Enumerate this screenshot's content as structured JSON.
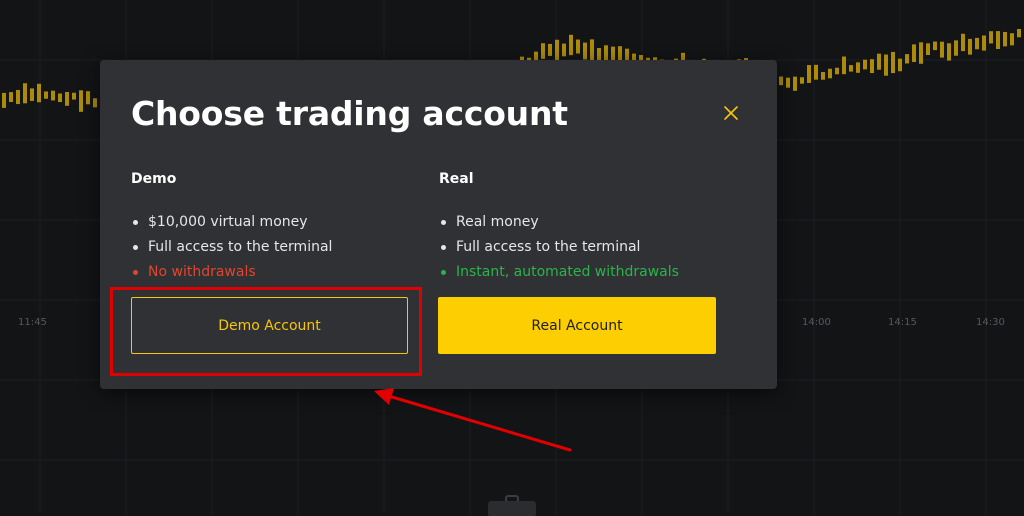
{
  "background": {
    "time_labels": [
      "11:45",
      "14:00",
      "14:15",
      "14:30"
    ],
    "candle_color": "#c9a008"
  },
  "modal": {
    "title": "Choose trading account",
    "close_icon": "close-x-icon",
    "demo": {
      "title": "Demo",
      "features": [
        {
          "text": "$10,000 virtual money",
          "status": "neutral"
        },
        {
          "text": "Full access to the terminal",
          "status": "neutral"
        },
        {
          "text": "No withdrawals",
          "status": "negative"
        }
      ],
      "button_label": "Demo Account"
    },
    "real": {
      "title": "Real",
      "features": [
        {
          "text": "Real money",
          "status": "neutral"
        },
        {
          "text": "Full access to the terminal",
          "status": "neutral"
        },
        {
          "text": "Instant, automated withdrawals",
          "status": "positive"
        }
      ],
      "button_label": "Real Account"
    }
  },
  "colors": {
    "accent": "#fdcf03",
    "negative": "#e2452f",
    "positive": "#2cb34a",
    "annotation": "#e00000"
  },
  "annotation": {
    "highlight_target": "demo-account-button",
    "arrow_icon": "red-arrow-icon"
  }
}
